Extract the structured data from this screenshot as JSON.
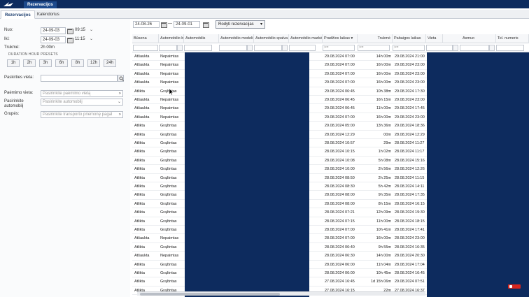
{
  "topbar": {
    "app_tab": "Rezervacijos"
  },
  "tabs": [
    "Rezervacijos",
    "Kalendorius"
  ],
  "filters": {
    "nuo_label": "Nuo:",
    "nuo_date": "24-09-03",
    "nuo_time": "09:15",
    "iki_label": "Iki:",
    "iki_date": "24-09-03",
    "iki_time": "11:15",
    "trukme_label": "Trukmė:",
    "trukme_value": "2h 00m",
    "presets_title": "DURATION HOUR PRESETS",
    "presets": [
      "1h",
      "2h",
      "3h",
      "6h",
      "8h",
      "12h",
      "24h"
    ],
    "paskirties_label": "Paskirties vieta:",
    "paemimo_label": "Paėmimo vieta:",
    "paemimo_placeholder": "Pasirinkite paėmimo vietą",
    "automobilis_label": "Pasirinkite automobilį",
    "automobilis_placeholder": "Pasirinkite automobilį",
    "grupes_label": "Grupės:",
    "grupes_placeholder": "Pasirinkite transporto priemonę pagal"
  },
  "toolbar": {
    "date_from": "24-08-26",
    "dash": "—",
    "date_to": "24-09-01",
    "show_button": "Rodyti rezervacijas"
  },
  "grid": {
    "columns": [
      "Būsena",
      "Automobilio b",
      "Automobilis",
      "Automobilio modelis",
      "Automobilio spalva",
      "Automobilio markė",
      "Pradžios laikas",
      "Trukmė",
      "Pabaigos laikas",
      "Vieta",
      "Asmuo",
      "Tel. numeris"
    ],
    "filter_placeholder": ">=",
    "rows": [
      [
        "Atšaukta",
        "Nepaimtas",
        "29.08.2024 07:00",
        "14h 00m",
        "29.08.2024 21:00"
      ],
      [
        "Atšaukta",
        "Nepaimtas",
        "29.08.2024 07:00",
        "16h 00m",
        "29.08.2024 23:00"
      ],
      [
        "Atšaukta",
        "Nepaimtas",
        "29.08.2024 07:00",
        "16h 00m",
        "29.08.2024 23:00"
      ],
      [
        "Atšaukta",
        "Nepaimtas",
        "29.08.2024 07:00",
        "16h 00m",
        "29.08.2024 23:00"
      ],
      [
        "Atlikta",
        "Grąžintas",
        "29.08.2024 06:45",
        "10h 38m",
        "29.08.2024 17:30"
      ],
      [
        "Atšaukta",
        "Nepaimtas",
        "29.08.2024 06:45",
        "16h 15m",
        "29.08.2024 23:00"
      ],
      [
        "Atšaukta",
        "Nepaimtas",
        "29.08.2024 06:45",
        "11h 00m",
        "29.08.2024 17:45"
      ],
      [
        "Atšaukta",
        "Nepaimtas",
        "29.08.2024 07:00",
        "16h 00m",
        "29.08.2024 23:00"
      ],
      [
        "Atlikta",
        "Grąžintas",
        "29.08.2024 05:00",
        "13h 36m",
        "29.08.2024 18:36"
      ],
      [
        "Atlikta",
        "Grąžintas",
        "28.08.2024 12:29",
        "00m",
        "28.08.2024 12:29"
      ],
      [
        "Atlikta",
        "Grąžintas",
        "28.08.2024 10:57",
        "29m",
        "28.08.2024 11:27"
      ],
      [
        "Atlikta",
        "Grąžintas",
        "28.08.2024 10:15",
        "1h 02m",
        "28.08.2024 11:17"
      ],
      [
        "Atlikta",
        "Grąžintas",
        "28.08.2024 10:08",
        "5h 08m",
        "28.08.2024 15:16"
      ],
      [
        "Atlikta",
        "Grąžintas",
        "28.08.2024 10:00",
        "2h 56m",
        "28.08.2024 12:26"
      ],
      [
        "Atlikta",
        "Grąžintas",
        "28.08.2024 08:50",
        "2h 25m",
        "28.08.2024 11:15"
      ],
      [
        "Atlikta",
        "Grąžintas",
        "28.08.2024 08:30",
        "5h 42m",
        "28.08.2024 14:11"
      ],
      [
        "Atlikta",
        "Grąžintas",
        "28.08.2024 08:00",
        "9h 35m",
        "28.08.2024 17:35"
      ],
      [
        "Atlikta",
        "Grąžintas",
        "28.08.2024 08:00",
        "8h 15m",
        "28.08.2024 16:15"
      ],
      [
        "Atlikta",
        "Grąžintas",
        "28.08.2024 07:21",
        "12h 09m",
        "28.08.2024 19:30"
      ],
      [
        "Atlikta",
        "Grąžintas",
        "28.08.2024 07:15",
        "11h 00m",
        "28.08.2024 18:15"
      ],
      [
        "Atlikta",
        "Grąžintas",
        "28.08.2024 07:00",
        "10h 41m",
        "28.08.2024 17:41"
      ],
      [
        "Atšaukta",
        "Nepaimtas",
        "28.08.2024 07:00",
        "16h 00m",
        "28.08.2024 23:00"
      ],
      [
        "Atlikta",
        "Grąžintas",
        "28.08.2024 06:40",
        "9h 55m",
        "28.08.2024 16:35"
      ],
      [
        "Atšaukta",
        "Nepaimtas",
        "28.08.2024 06:30",
        "14h 00m",
        "28.08.2024 20:30"
      ],
      [
        "Atlikta",
        "Grąžintas",
        "28.08.2024 06:00",
        "11h 04m",
        "28.08.2024 17:04"
      ],
      [
        "Atlikta",
        "Grąžintas",
        "28.08.2024 06:00",
        "10h 45m",
        "28.08.2024 16:45"
      ],
      [
        "Atlikta",
        "Grąžintas",
        "27.08.2024 16:45",
        "1d 15h 06m",
        "29.08.2024 07:51"
      ],
      [
        "Atlikta",
        "Grąžintas",
        "27.08.2024 16:15",
        "22m",
        "27.08.2024 16:37"
      ]
    ]
  }
}
